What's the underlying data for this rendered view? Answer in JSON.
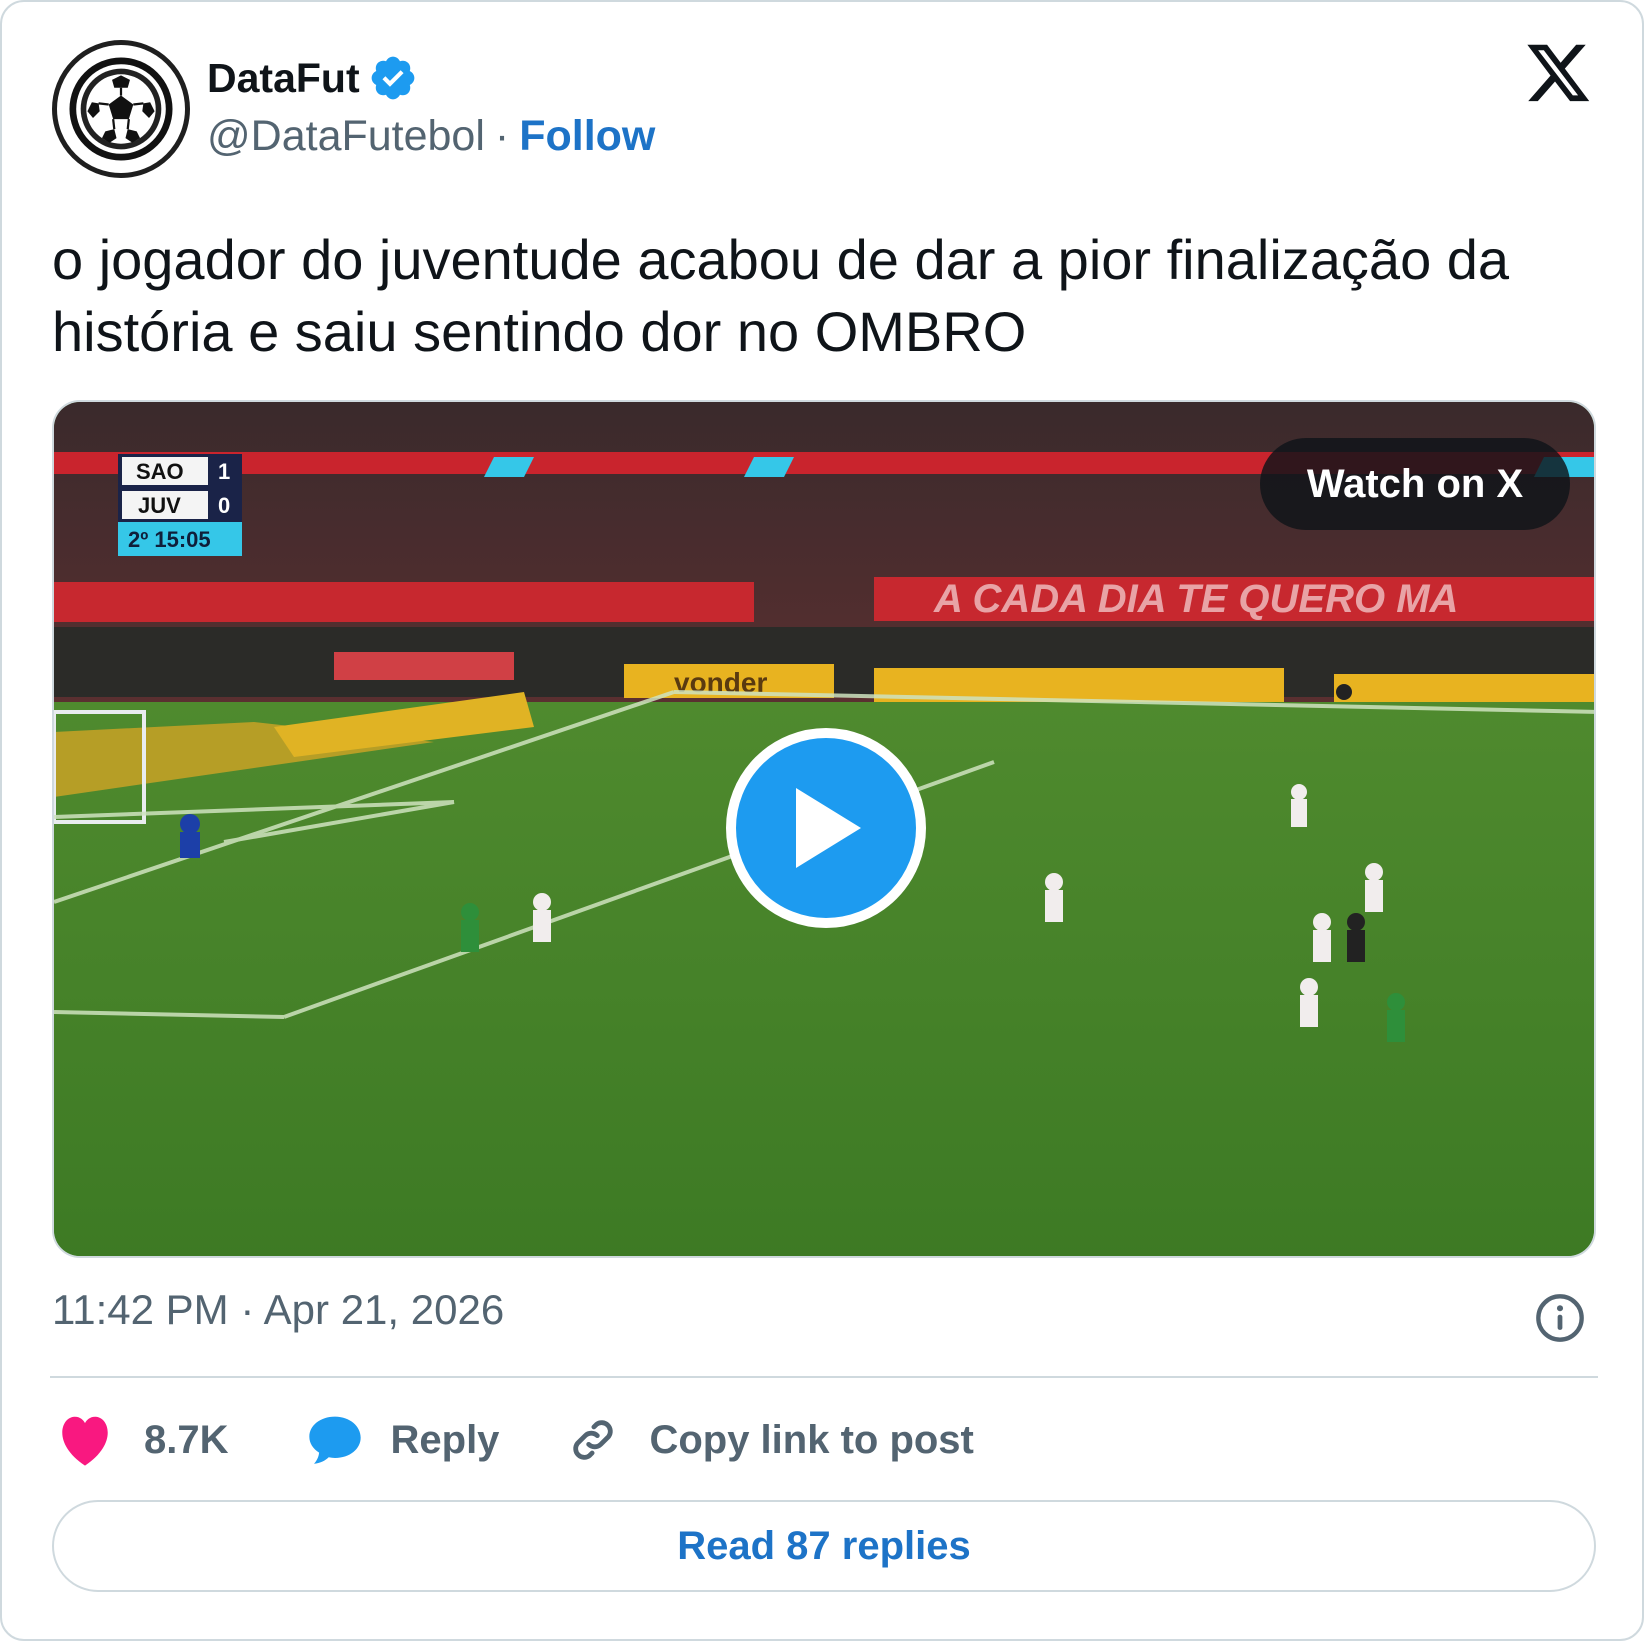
{
  "author": {
    "name": "DataFut",
    "handle": "@DataFutebol",
    "separator": "·",
    "follow_label": "Follow",
    "verified": true
  },
  "tweet": {
    "text": "o jogador do juventude acabou de dar a pior finalização da história e saiu sentindo dor no OMBRO"
  },
  "media": {
    "watch_label": "Watch on X",
    "scoreboard": {
      "home_team": "SAO",
      "home_score": "1",
      "away_team": "JUV",
      "away_score": "0",
      "clock": "2º 15:05"
    },
    "banner_text": "A CADA DIA TE QUERO MA",
    "ad_text": "vonder"
  },
  "timestamp": "11:42 PM · Apr 21, 2026",
  "actions": {
    "likes": "8.7K",
    "reply_label": "Reply",
    "copy_label": "Copy link to post"
  },
  "read_replies_label": "Read 87 replies",
  "colors": {
    "accent": "#1d9bf0",
    "link": "#1d73c7",
    "like": "#f91880",
    "muted": "#536471"
  }
}
